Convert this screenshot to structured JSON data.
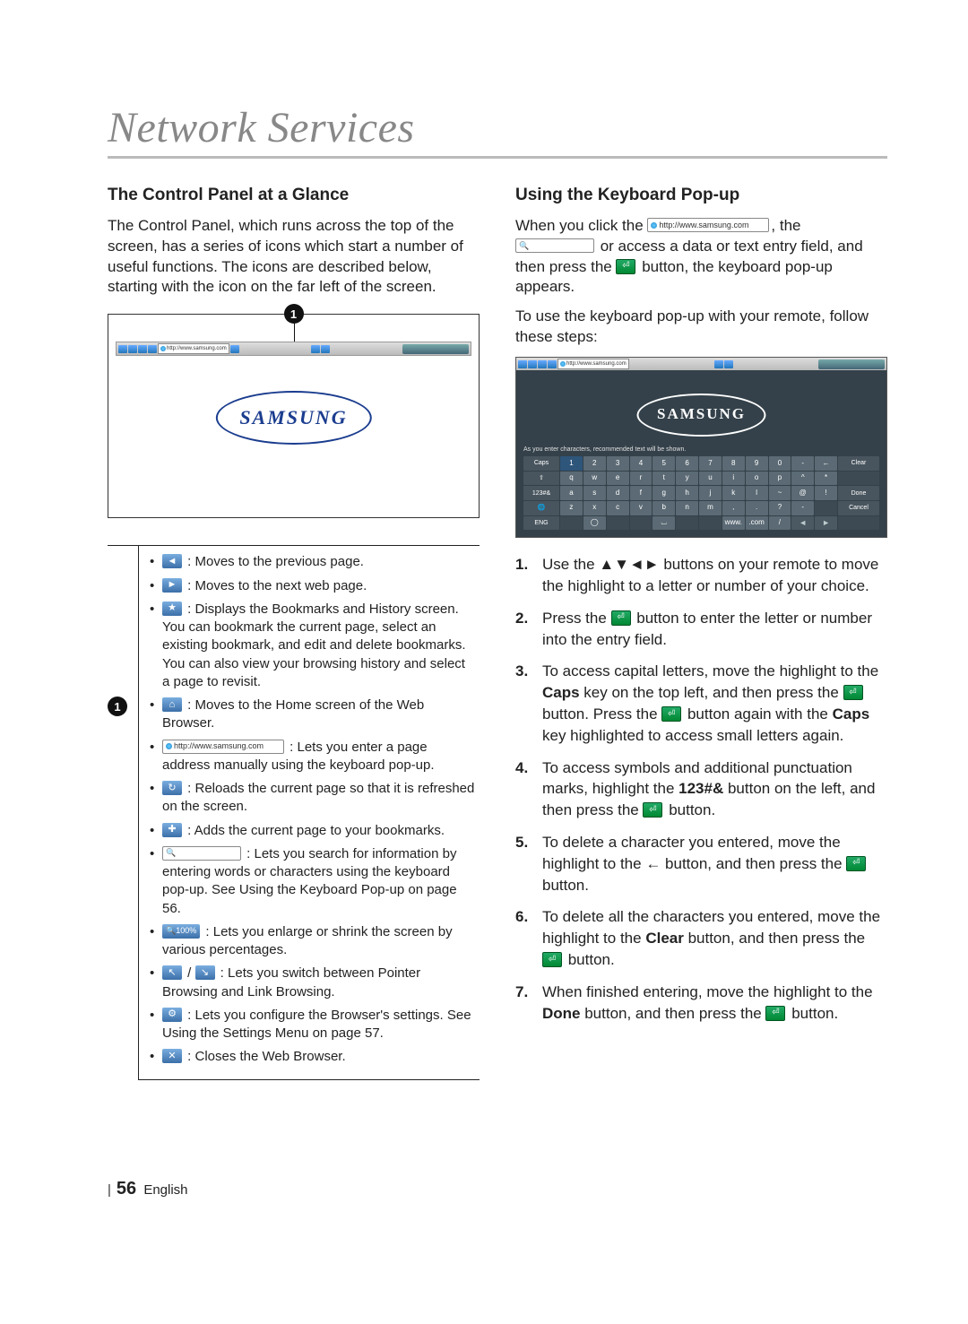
{
  "title": "Network Services",
  "left": {
    "heading": "The Control Panel at a Glance",
    "intro": "The Control Panel, which runs across the top of the screen, has a series of icons which start a number of useful functions. The icons are described below, starting with the icon on the far left of the screen.",
    "callout": "1",
    "toolbar_url": "http://www.samsung.com",
    "logo": "SAMSUNG",
    "legend_marker": "1",
    "items": {
      "back": " : Moves to the previous page.",
      "forward": " : Moves to the next web page.",
      "bookmarks": " : Displays the Bookmarks and History screen. You can bookmark the current page, select an existing bookmark, and edit and delete bookmarks. You can also view your browsing history and select a page to revisit.",
      "home": " : Moves to the Home screen of the Web Browser.",
      "url_box_text": "http://www.samsung.com",
      "url": " : Lets you enter a page address manually using the keyboard pop-up.",
      "reload": " : Reloads the current page so that it is refreshed on the screen.",
      "addbm": " : Adds the current page to your bookmarks.",
      "search": " : Lets you search for information by entering words or characters using the keyboard pop-up. See Using the Keyboard Pop-up on page 56.",
      "zoom_label": "100%",
      "zoom": " : Lets you enlarge or shrink the screen by various percentages.",
      "pointer": " : Lets you switch between Pointer Browsing and Link Browsing.",
      "settings": " : Lets you configure the Browser's settings. See Using the Settings Menu on page 57.",
      "close": " : Closes the Web Browser."
    }
  },
  "right": {
    "heading": "Using the Keyboard Pop-up",
    "p1a": "When you click the ",
    "url_box_text": "http://www.samsung.com",
    "p1b": ", the ",
    "p1c": " or access a data or text entry field, and then press the ",
    "p1d": " button, the keyboard pop-up appears.",
    "p2": "To use the keyboard pop-up with your remote, follow these steps:",
    "kb": {
      "toolbar_url": "http://www.samsung.com",
      "logo": "SAMSUNG",
      "hint": "As you enter characters, recommended text will be shown.",
      "rows": [
        [
          "Caps",
          "1",
          "2",
          "3",
          "4",
          "5",
          "6",
          "7",
          "8",
          "9",
          "0",
          "-",
          "←",
          "Clear"
        ],
        [
          "⇧",
          "q",
          "w",
          "e",
          "r",
          "t",
          "y",
          "u",
          "i",
          "o",
          "p",
          "^",
          "*",
          ""
        ],
        [
          "123#&",
          "a",
          "s",
          "d",
          "f",
          "g",
          "h",
          "j",
          "k",
          "l",
          "~",
          "@",
          "!",
          "Done"
        ],
        [
          "🌐",
          "z",
          "x",
          "c",
          "v",
          "b",
          "n",
          "m",
          ",",
          ".",
          "?",
          "-",
          "",
          "Cancel"
        ],
        [
          "ENG",
          "",
          "◯",
          "",
          "",
          "⌴",
          "",
          "",
          "www.",
          ".com",
          "/",
          "◄",
          "►",
          ""
        ]
      ]
    },
    "steps": {
      "s1a": "Use the ",
      "s1_arrows": "▲▼◄►",
      "s1b": " buttons on your remote to move the highlight to a letter or number of your choice.",
      "s2a": "Press the ",
      "s2b": " button to enter the letter or number into the entry field.",
      "s3a": "To access capital letters, move the highlight to the ",
      "s3_caps": "Caps",
      "s3b": " key on the top left, and then press the ",
      "s3c": " button. Press the ",
      "s3d": " button again with the ",
      "s3e": " key highlighted to access small letters again.",
      "s4a": "To access symbols and additional punctuation marks, highlight the ",
      "s4_sym": "123#&",
      "s4b": " button on the left, and then press the ",
      "s4c": " button.",
      "s5a": "To delete a character you entered, move the highlight to the ",
      "s5_back": "←",
      "s5b": " button, and then press the ",
      "s5c": " button.",
      "s6a": "To delete all the characters you entered, move the highlight to the ",
      "s6_clear": "Clear",
      "s6b": " button, and then press the ",
      "s6c": " button.",
      "s7a": "When finished entering, move the highlight to the ",
      "s7_done": "Done",
      "s7b": " button, and then press the ",
      "s7c": " button."
    }
  },
  "footer": {
    "page": "56",
    "lang": "English"
  }
}
